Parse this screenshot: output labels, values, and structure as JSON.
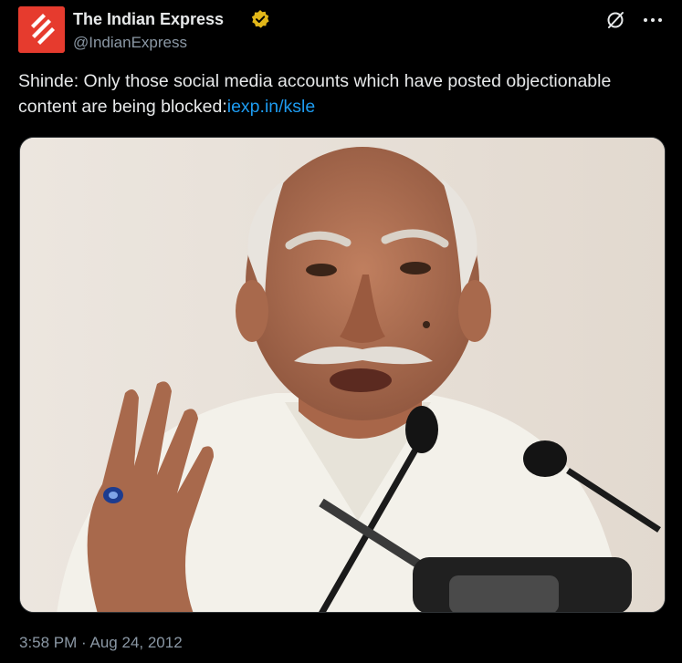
{
  "account": {
    "display_name": "The Indian Express",
    "handle": "@IndianExpress",
    "verified": true,
    "verified_color": "#e2b719",
    "avatar_color": "#e63b2e"
  },
  "tweet": {
    "text": "Shinde: Only those social media accounts which have posted objectionable content are being blocked:",
    "link_text": "iexp.in/ksle",
    "link_color": "#1d9bf0"
  },
  "media": {
    "image_alt_description": "Photo of a man speaking at microphones"
  },
  "meta": {
    "time": "3:58 PM",
    "separator": "·",
    "date": "Aug 24, 2012"
  },
  "icons": {
    "grok": "grok-slash-icon",
    "more": "more-horizontal-icon"
  }
}
